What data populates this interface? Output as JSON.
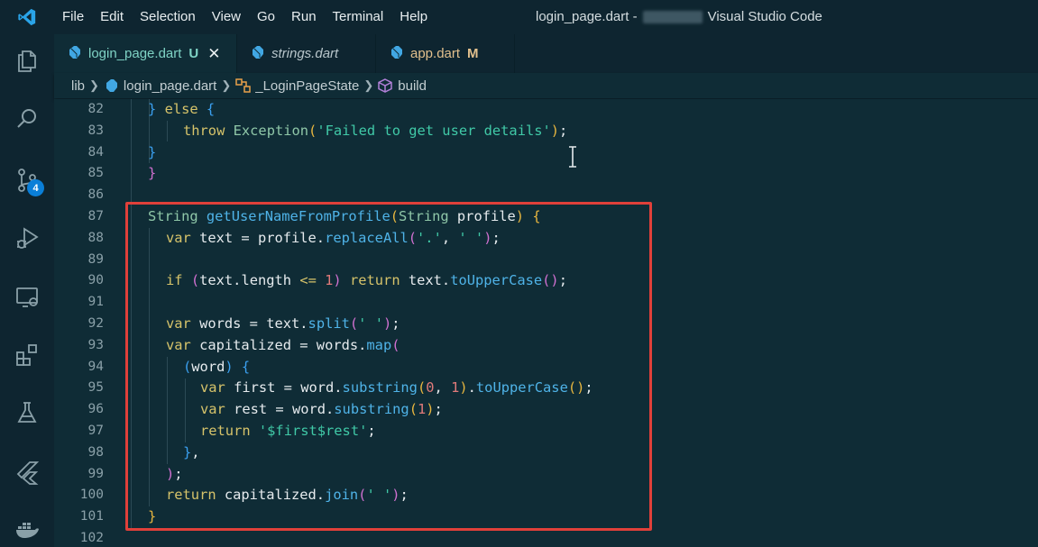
{
  "app": {
    "menu": [
      "File",
      "Edit",
      "Selection",
      "View",
      "Go",
      "Run",
      "Terminal",
      "Help"
    ],
    "window_title_prefix": "login_page.dart -",
    "window_title_suffix": "Visual Studio Code"
  },
  "activity_bar": {
    "items": [
      "explorer-icon",
      "search-icon",
      "source-control-icon",
      "run-debug-icon",
      "remote-explorer-icon",
      "extensions-icon",
      "testing-icon",
      "flutter-icon",
      "docker-icon"
    ],
    "source_control_badge": "4"
  },
  "tabs": [
    {
      "label": "login_page.dart",
      "modifier": "U",
      "active": true
    },
    {
      "label": "strings.dart",
      "modifier": "",
      "active": false
    },
    {
      "label": "app.dart",
      "modifier": "M",
      "active": false
    }
  ],
  "breadcrumb": {
    "folder": "lib",
    "file": "login_page.dart",
    "class": "_LoginPageState",
    "method": "build"
  },
  "editor": {
    "line_numbers": [
      "82",
      "83",
      "84",
      "85",
      "86",
      "87",
      "88",
      "89",
      "90",
      "91",
      "92",
      "93",
      "94",
      "95",
      "96",
      "97",
      "98",
      "99",
      "100",
      "101",
      "102"
    ]
  },
  "colors": {
    "highlight_border": "#e0403a",
    "badge": "#0a7fd8",
    "background": "#0f2c36"
  }
}
